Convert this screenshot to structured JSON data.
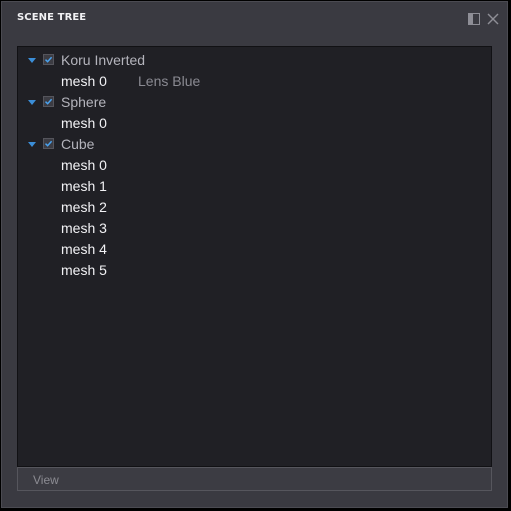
{
  "panel": {
    "title": "SCENE TREE",
    "dock_icon": "dock-panel-icon",
    "close_icon": "close-icon"
  },
  "tree": [
    {
      "label": "Koru Inverted",
      "expanded": true,
      "checked": true,
      "meshes": [
        {
          "label": "mesh 0",
          "material": "Lens Blue"
        }
      ]
    },
    {
      "label": "Sphere",
      "expanded": true,
      "checked": true,
      "meshes": [
        {
          "label": "mesh 0"
        }
      ]
    },
    {
      "label": "Cube",
      "expanded": true,
      "checked": true,
      "meshes": [
        {
          "label": "mesh 0"
        },
        {
          "label": "mesh 1"
        },
        {
          "label": "mesh 2"
        },
        {
          "label": "mesh 3"
        },
        {
          "label": "mesh 4"
        },
        {
          "label": "mesh 5"
        }
      ]
    }
  ],
  "footer": {
    "view_label": "View"
  },
  "colors": {
    "accent": "#3b8ed8",
    "tree_bg": "#202025",
    "panel_bg": "#3a3a41"
  }
}
